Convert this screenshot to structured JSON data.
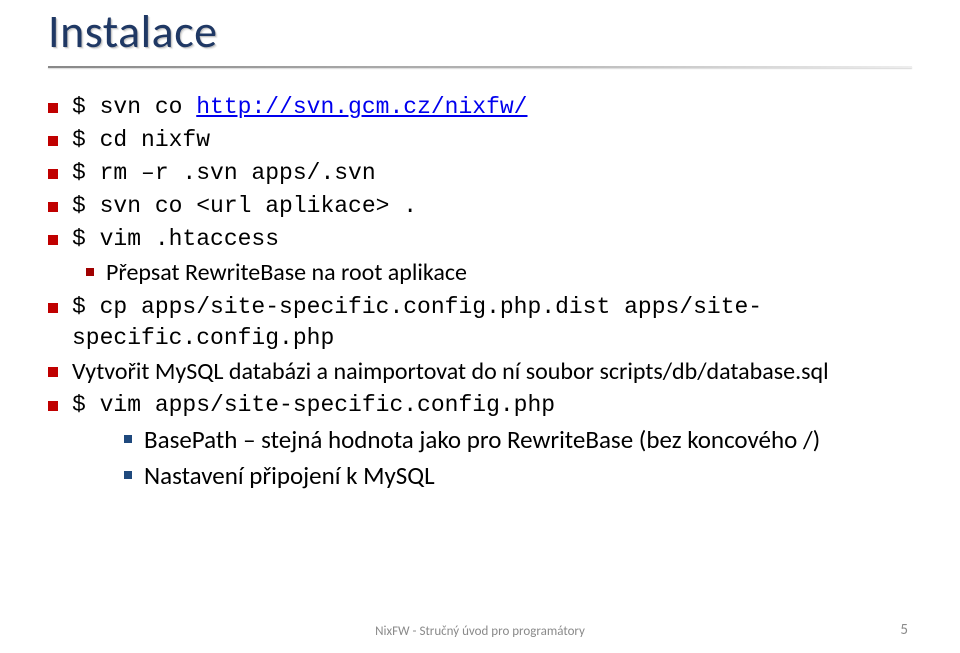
{
  "title": "Instalace",
  "lines": {
    "l1": "$ svn co ",
    "l1_link": "http://svn.gcm.cz/nixfw/",
    "l2": "$ cd nixfw",
    "l3": "$ rm –r .svn apps/.svn",
    "l4": "$ svn co <url aplikace> .",
    "l5": "$ vim .htaccess",
    "l6": "Přepsat RewriteBase na root aplikace",
    "l7": "$ cp apps/site-specific.config.php.dist  apps/site-specific.config.php",
    "l8a": "Vytvořit MySQL databázi a naimportovat do ní soubor ",
    "l8b": "scripts/db/database.sql",
    "l9": "$ vim apps/site-specific.config.php",
    "l10": "BasePath – stejná hodnota jako pro RewriteBase (bez koncového /)",
    "l11": "Nastavení připojení k MySQL"
  },
  "footer": "NixFW - Stručný úvod pro programátory",
  "page": "5"
}
